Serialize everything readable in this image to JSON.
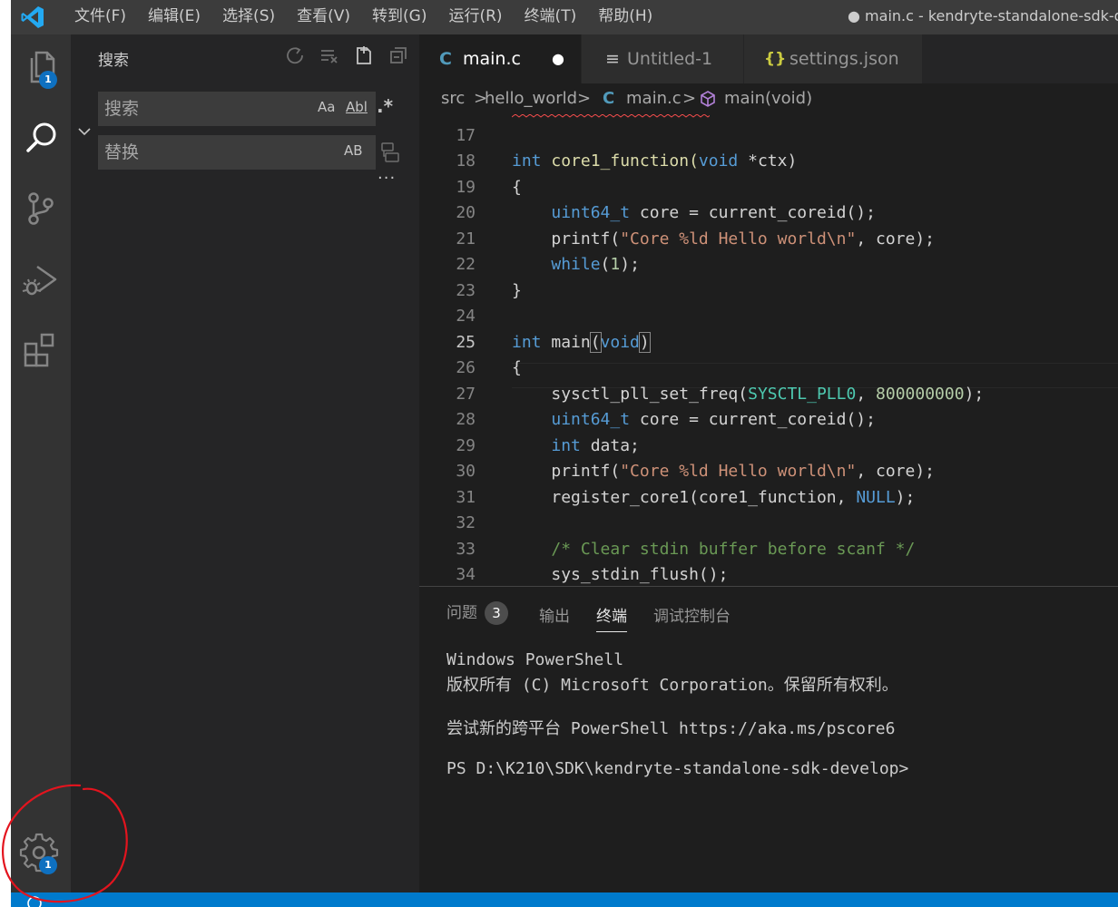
{
  "window": {
    "title": "● main.c - kendryte-standalone-sdk-d",
    "menu": [
      "文件(F)",
      "编辑(E)",
      "选择(S)",
      "查看(V)",
      "转到(G)",
      "运行(R)",
      "终端(T)",
      "帮助(H)"
    ]
  },
  "activity_bar": {
    "explorer_badge": "1",
    "settings_badge": "1",
    "icons": [
      "files-icon",
      "search-icon",
      "source-control-icon",
      "run-debug-icon",
      "extensions-icon",
      "gear-icon"
    ]
  },
  "search_view": {
    "title": "搜索",
    "search_placeholder": "搜索",
    "replace_placeholder": "替换",
    "opt_match_case": "Aa",
    "opt_whole_word": "Abl",
    "opt_regex": ".*",
    "opt_preserve_case": "AB",
    "more": "···"
  },
  "tabs": [
    {
      "lang": "C",
      "label": "main.c",
      "modified": "●"
    },
    {
      "lang": "≡",
      "label": "Untitled-1"
    },
    {
      "lang": "{}",
      "label": "settings.json"
    }
  ],
  "breadcrumb": {
    "folder1": "src",
    "folder2": "hello_world",
    "file_lang": "C",
    "file": "main.c",
    "symbol": "main(void)",
    "sep": ">"
  },
  "code_lines": [
    {
      "n": "17"
    },
    {
      "n": "18"
    },
    {
      "n": "19"
    },
    {
      "n": "20"
    },
    {
      "n": "21"
    },
    {
      "n": "22"
    },
    {
      "n": "23"
    },
    {
      "n": "24"
    },
    {
      "n": "25"
    },
    {
      "n": "26"
    },
    {
      "n": "27"
    },
    {
      "n": "28"
    },
    {
      "n": "29"
    },
    {
      "n": "30"
    },
    {
      "n": "31"
    },
    {
      "n": "32"
    },
    {
      "n": "33"
    },
    {
      "n": "34"
    }
  ],
  "code": {
    "l18_kw": "int",
    "l18_fn": " core1_function(",
    "l18_kw2": "void",
    "l18_rest": " *ctx)",
    "l19": "{",
    "l20_ty": "uint64_t",
    "l20_rest": " core = current_coreid();",
    "l21_a": "printf(",
    "l21_str": "\"Core %ld Hello world\\n\"",
    "l21_b": ", core);",
    "l22_kw": "while",
    "l22_a": "(",
    "l22_num": "1",
    "l22_b": ");",
    "l23": "}",
    "l25_kw": "int",
    "l25_fn": " main",
    "l25_po": "(",
    "l25_kw2": "void",
    "l25_pc": ")",
    "l26": "{",
    "l27_a": "sysctl_pll_set_freq(",
    "l27_en": "SYSCTL_PLL0",
    "l27_b": ", ",
    "l27_num": "800000000",
    "l27_c": ");",
    "l28_ty": "uint64_t",
    "l28_rest": " core = current_coreid();",
    "l29_kw": "int",
    "l29_rest": " data;",
    "l30_a": "printf(",
    "l30_str": "\"Core %ld Hello world\\n\"",
    "l30_b": ", core);",
    "l31_a": "register_core1(core1_function, ",
    "l31_en": "NULL",
    "l31_b": ");",
    "l33_cm": "/* Clear stdin buffer before scanf */",
    "l34": "sys_stdin_flush();"
  },
  "panel": {
    "tabs": [
      "问题",
      "输出",
      "终端",
      "调试控制台"
    ],
    "problems_count": "3",
    "terminal": [
      "Windows PowerShell",
      "版权所有 (C) Microsoft Corporation。保留所有权利。",
      "尝试新的跨平台 PowerShell https://aka.ms/pscore6",
      "PS D:\\K210\\SDK\\kendryte-standalone-sdk-develop>"
    ]
  },
  "colors": {
    "accent": "#007acc",
    "badge": "#0e70c0",
    "annotation": "#e3141e"
  }
}
